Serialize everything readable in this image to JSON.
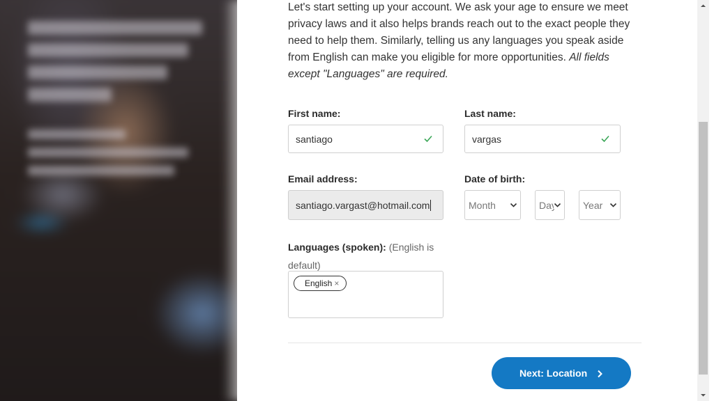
{
  "intro": {
    "text": "Let's start setting up your account. We ask your age to ensure we meet privacy laws and it also helps brands reach out to the exact people they need to help them. Similarly, telling us any languages you speak aside from English can make you eligible for more opportunities.",
    "required_note": "All fields except \"Languages\" are required."
  },
  "form": {
    "first_name": {
      "label": "First name:",
      "value": "santiago"
    },
    "last_name": {
      "label": "Last name:",
      "value": "vargas"
    },
    "email": {
      "label": "Email address:",
      "value": "santiago.vargast@hotmail.com"
    },
    "dob": {
      "label": "Date of birth:",
      "month": "Month",
      "day": "Day",
      "year": "Year"
    },
    "languages": {
      "label": "Languages (spoken):",
      "note": "(English is default)",
      "tags": [
        "English"
      ],
      "remove_glyph": "×"
    }
  },
  "actions": {
    "next_label": "Next: Location"
  },
  "colors": {
    "primary": "#1479c4",
    "valid_check": "#3aa657",
    "email_bg": "#ebebeb"
  }
}
